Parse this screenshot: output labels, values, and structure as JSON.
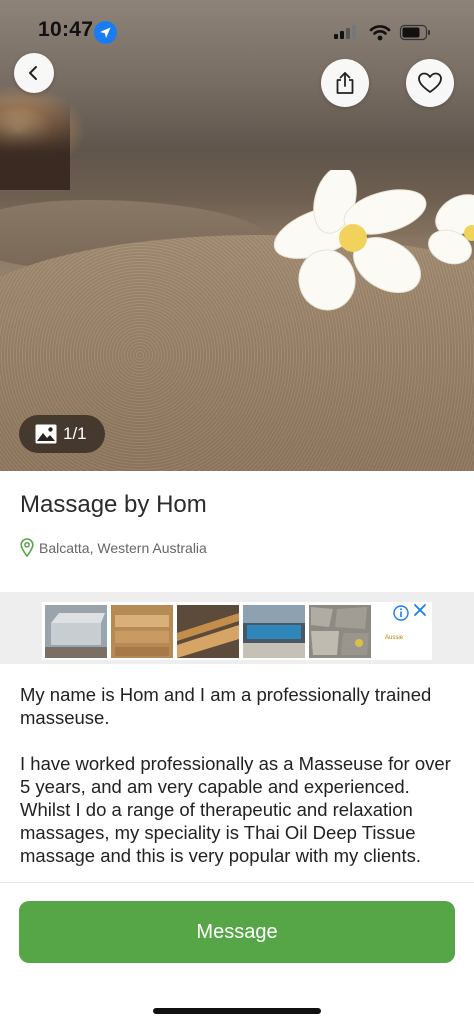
{
  "status_bar": {
    "time": "10:47"
  },
  "gallery": {
    "counter": "1/1"
  },
  "listing": {
    "title": "Massage by Hom",
    "location": "Balcatta, Western Australia"
  },
  "ad": {
    "brand": "Aussie"
  },
  "description": {
    "paragraphs": [
      "My name is Hom and I am a professionally trained masseuse.",
      "I have worked professionally as a Masseuse for over 5 years, and am very capable and experienced. Whilst I do a range of therapeutic and relaxation massages, my speciality is Thai Oil Deep Tissue massage and this is very popular with my clients."
    ]
  },
  "actions": {
    "message_label": "Message"
  },
  "colors": {
    "accent_green": "#56a648",
    "ios_blue": "#1a7cf5"
  }
}
